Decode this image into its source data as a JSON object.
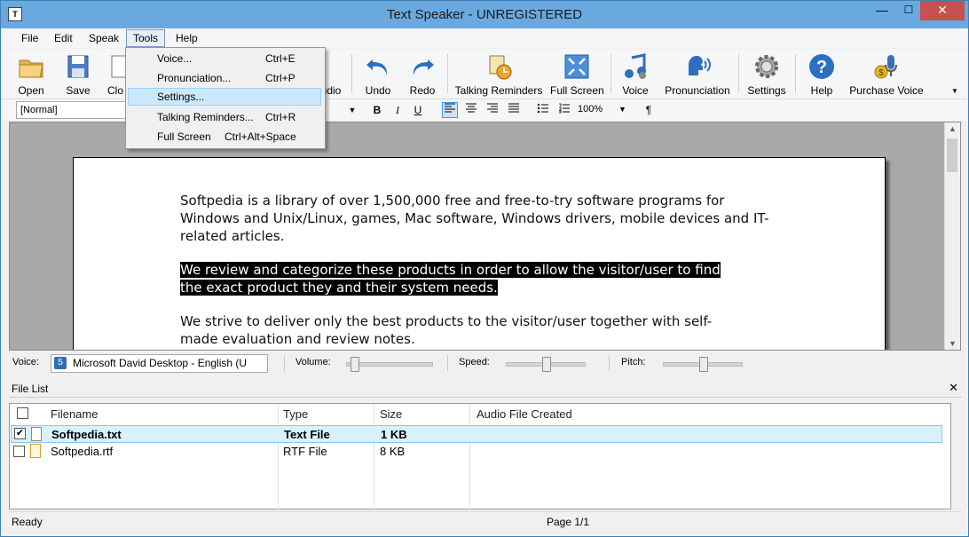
{
  "window": {
    "title": "Text Speaker - UNREGISTERED",
    "app_icon": "speaker-app-icon"
  },
  "menubar": {
    "items": [
      "File",
      "Edit",
      "Speak",
      "Tools",
      "Help"
    ],
    "open": "Tools"
  },
  "toolbar": {
    "open": "Open",
    "save": "Save",
    "close_partial": "Clo",
    "audio_partial": "udio",
    "undo": "Undo",
    "redo": "Redo",
    "talking_reminders": "Talking Reminders",
    "full_screen": "Full Screen",
    "voice": "Voice",
    "pronunciation": "Pronunciation",
    "settings": "Settings",
    "help": "Help",
    "purchase_voice": "Purchase Voice"
  },
  "formatbar": {
    "style": "[Normal]",
    "bold": "B",
    "italic": "I",
    "underline": "U",
    "zoom": "100%",
    "paragraph": "¶"
  },
  "document": {
    "p1": "Softpedia is a library of over 1,500,000 free and free-to-try software programs for Windows and Unix/Linux, games, Mac software, Windows drivers, mobile devices and IT-related articles.",
    "p2_line1": "We review and categorize these products in order to allow the visitor/user to find ",
    "p2_line2": "the exact product they and their system needs. ",
    "p3": "We strive to deliver only the best products to the visitor/user together with self-made evaluation and review notes."
  },
  "voicebar": {
    "voice_label": "Voice:",
    "voice_value": "Microsoft David Desktop - English (U",
    "volume_label": "Volume:",
    "speed_label": "Speed:",
    "pitch_label": "Pitch:",
    "volume_level": 0.05,
    "speed_level": 0.5,
    "pitch_level": 0.5
  },
  "filelist": {
    "title": "File List",
    "columns": [
      "Filename",
      "Type",
      "Size",
      "Audio File Created"
    ],
    "rows": [
      {
        "filename": "Softpedia.txt",
        "type": "Text File",
        "size": "1 KB",
        "audio": "",
        "checked": true
      },
      {
        "filename": "Softpedia.rtf",
        "type": "RTF File",
        "size": "8 KB",
        "audio": "",
        "checked": false
      }
    ]
  },
  "statusbar": {
    "status": "Ready",
    "page": "Page 1/1"
  },
  "tools_menu": {
    "items": [
      {
        "label": "Voice...",
        "shortcut": "Ctrl+E"
      },
      {
        "label": "Pronunciation...",
        "shortcut": "Ctrl+P"
      },
      {
        "label": "Settings...",
        "shortcut": ""
      },
      {
        "label": "Talking Reminders...",
        "shortcut": "Ctrl+R"
      },
      {
        "label": "Full Screen",
        "shortcut": "Ctrl+Alt+Space"
      }
    ],
    "highlighted": "Settings..."
  },
  "colors": {
    "titlebar": "#6aa9e0",
    "selection": "#000000",
    "menu_highlight": "#cce8ff",
    "close_button": "#c75050"
  }
}
